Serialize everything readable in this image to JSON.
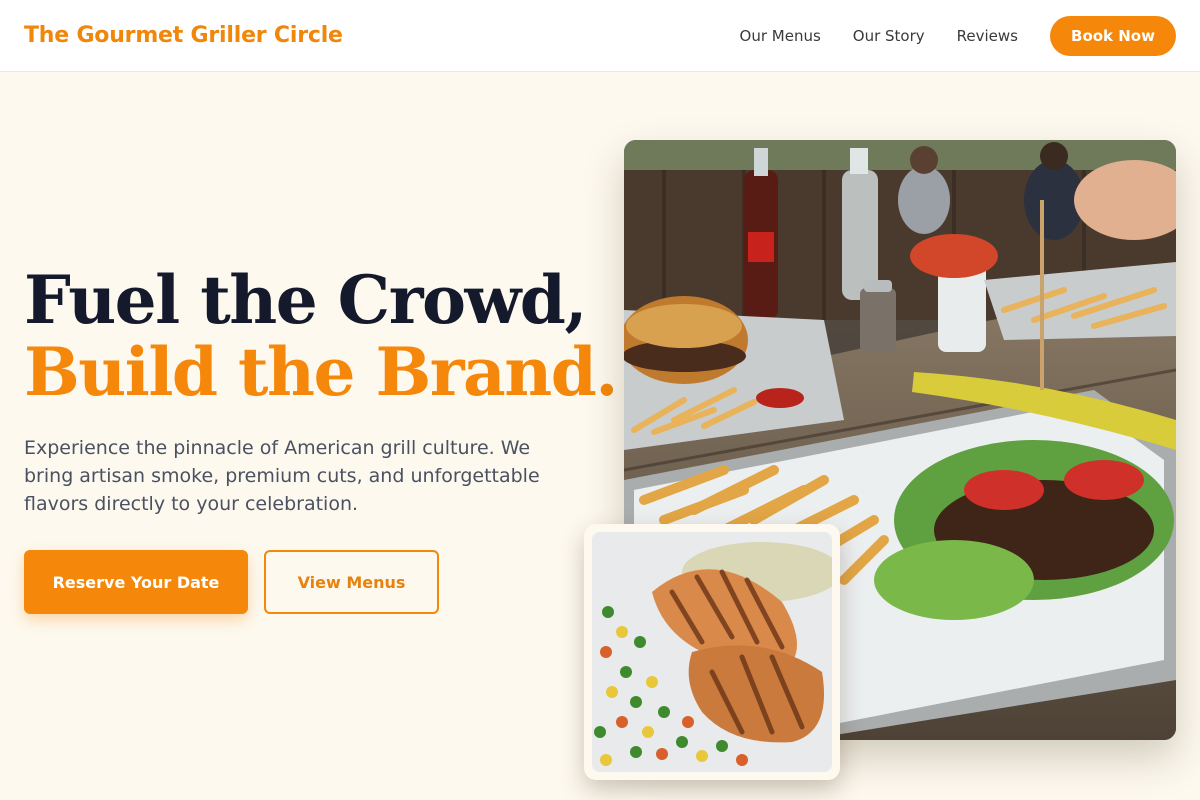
{
  "header": {
    "brand": "The Gourmet Griller Circle",
    "nav": [
      "Our Menus",
      "Our Story",
      "Reviews"
    ],
    "cta": "Book Now"
  },
  "hero": {
    "title_line1": "Fuel the Crowd,",
    "title_line2": "Build the Brand.",
    "subtitle": "Experience the pinnacle of American grill culture. We bring artisan smoke, premium cuts, and unforgettable flavors directly to your celebration.",
    "primary_cta": "Reserve Your Date",
    "secondary_cta": "View Menus"
  },
  "images": {
    "main": "photo-burger-fries-outdoor-table",
    "inset": "photo-grilled-chicken-mixed-vegetables"
  },
  "colors": {
    "accent": "#f5880a",
    "heading": "#141a2b",
    "background": "#fdf9ef",
    "body_text": "#4a5160"
  }
}
